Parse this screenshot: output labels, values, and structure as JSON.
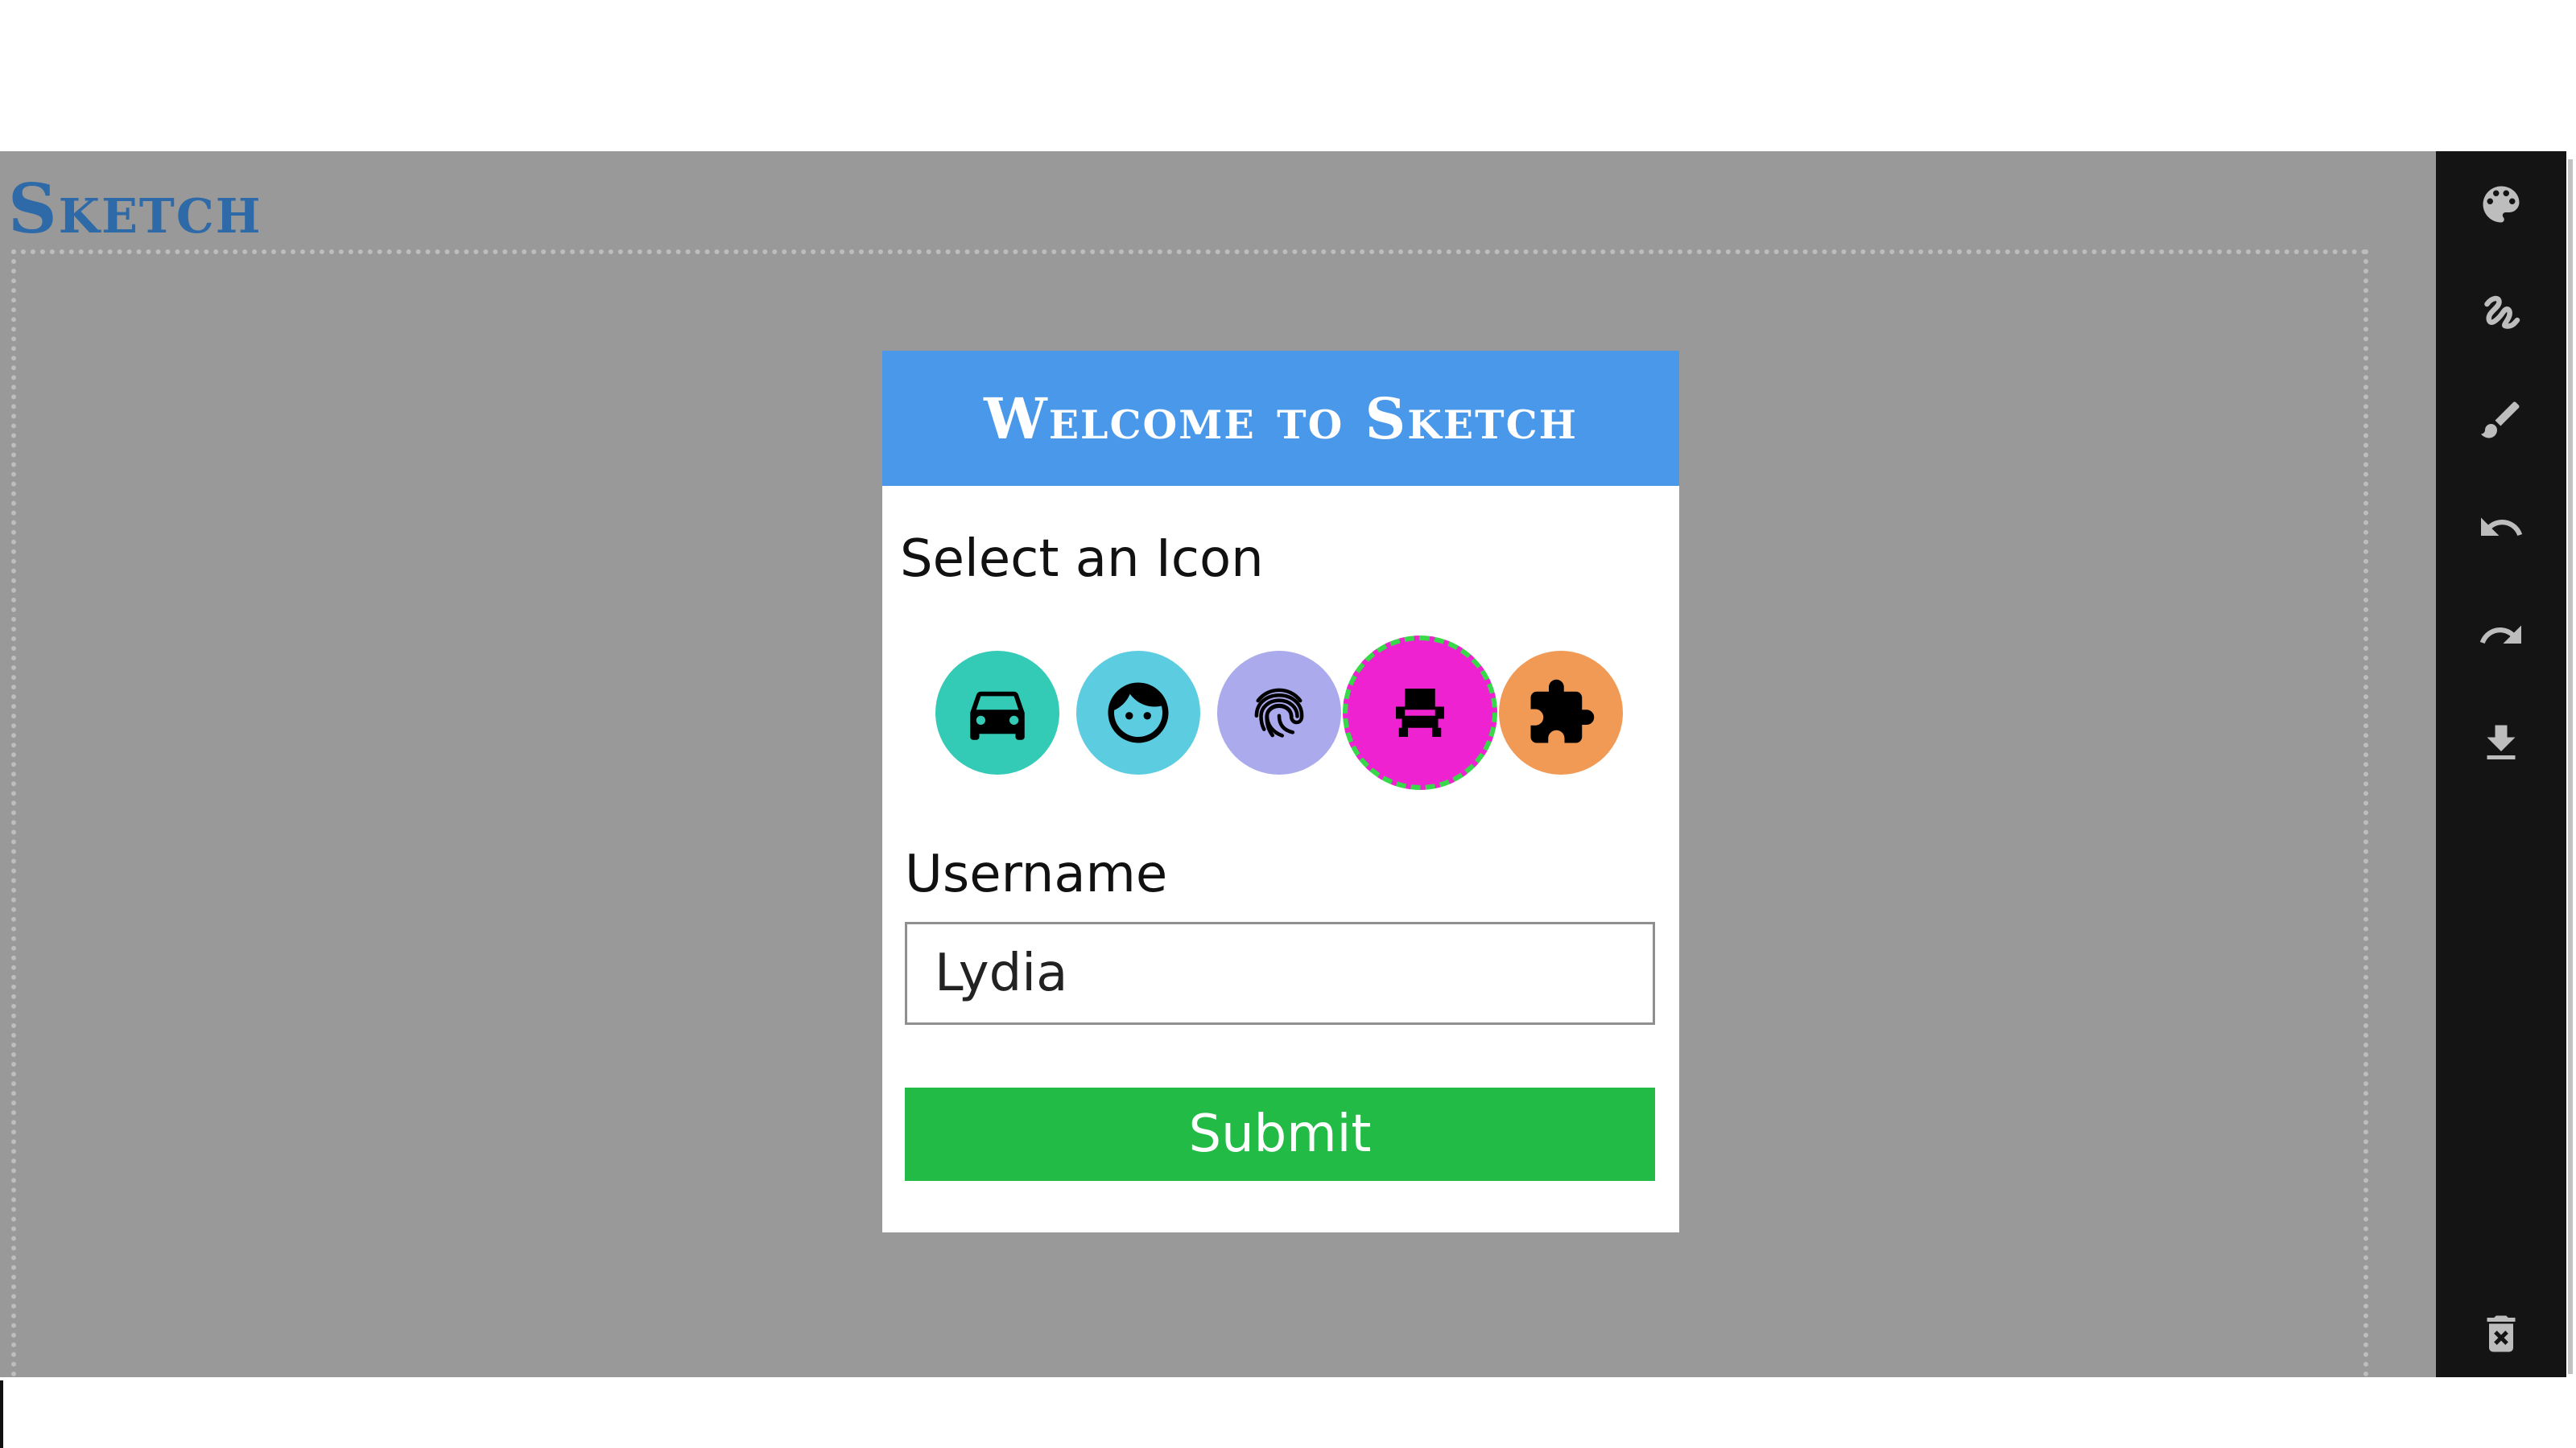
{
  "app": {
    "title": "Sketch"
  },
  "modal": {
    "title": "Welcome to Sketch",
    "select_label": "Select an Icon",
    "icons": [
      {
        "name": "car-icon",
        "color": "#33cbb6",
        "selected": false
      },
      {
        "name": "face-icon",
        "color": "#5ccde0",
        "selected": false
      },
      {
        "name": "fingerprint-icon",
        "color": "#aaaaec",
        "selected": false
      },
      {
        "name": "seat-icon",
        "color": "#ee22d1",
        "selected": true
      },
      {
        "name": "puzzle-icon",
        "color": "#f09a55",
        "selected": false
      }
    ],
    "username_label": "Username",
    "username_value": "Lydia",
    "submit_label": "Submit"
  },
  "toolbar": {
    "tools": [
      "palette-icon",
      "scribble-icon",
      "brush-icon",
      "undo-icon",
      "redo-icon",
      "download-icon",
      "delete-icon"
    ]
  },
  "colors": {
    "background": "#999999",
    "header": "#4a98ea",
    "submit": "#22bb46",
    "toolbar": "#141414",
    "title": "#2f6aa8",
    "selected_border": "#39d84b"
  }
}
